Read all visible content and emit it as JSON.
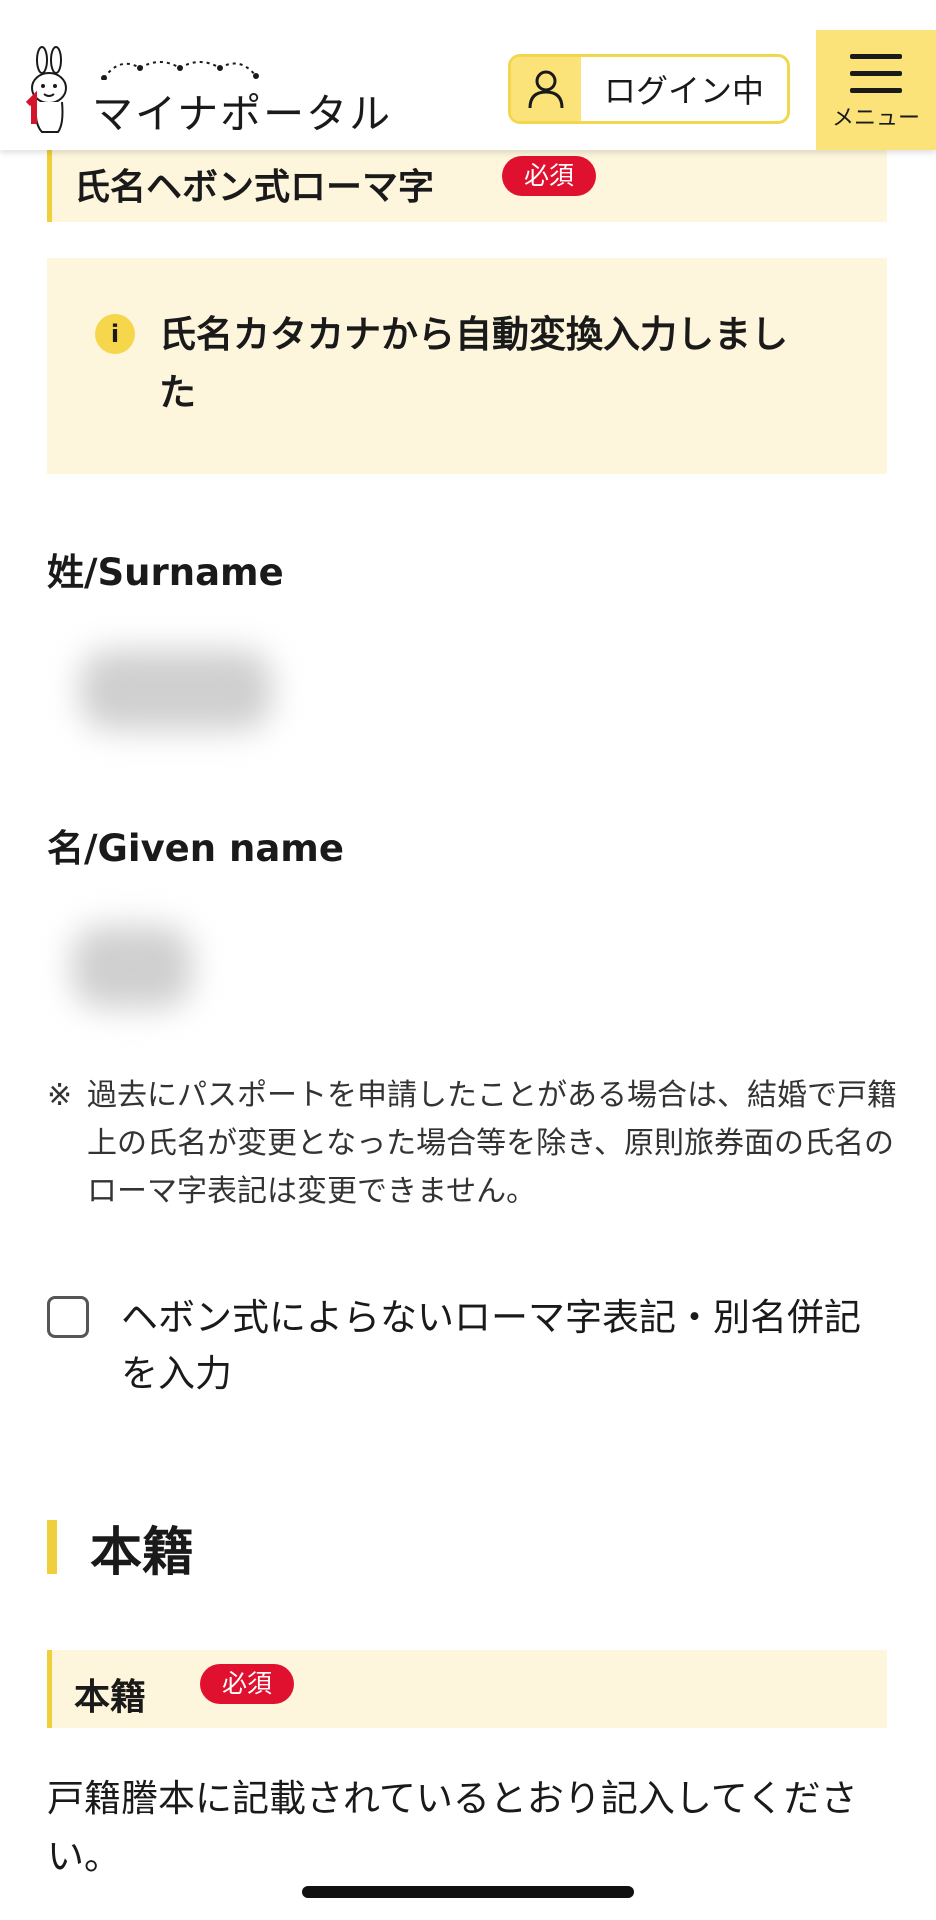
{
  "header": {
    "logo_text": "マイナポータル",
    "login_label": "ログイン中",
    "menu_label": "メニュー"
  },
  "romaji_section": {
    "title": "氏名ヘボン式ローマ字",
    "required_badge": "必須",
    "info_message": "氏名カタカナから自動変換入力しました",
    "surname_label": "姓/Surname",
    "given_name_label": "名/Given name",
    "note_mark": "※",
    "note_text": "過去にパスポートを申請したことがある場合は、結婚で戸籍上の氏名が変更となった場合等を除き、原則旅券面の氏名のローマ字表記は変更できません。",
    "checkbox_label": "ヘボン式によらないローマ字表記・別名併記を入力",
    "checkbox_checked": false
  },
  "honseki_section": {
    "heading": "本籍",
    "field_label": "本籍",
    "required_badge": "必須",
    "instruction": "戸籍謄本に記載されているとおり記入してください。"
  },
  "colors": {
    "accent_yellow": "#fbe37a",
    "bar_border": "#f0cf3c",
    "band_background": "#fdf6dd",
    "required_red": "#e0102f"
  }
}
